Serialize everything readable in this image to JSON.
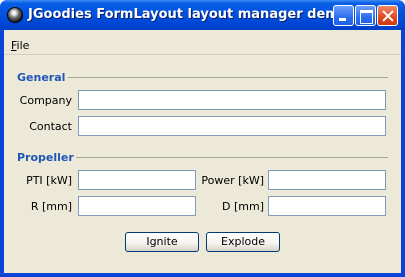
{
  "window": {
    "title": "JGoodies FormLayout layout manager demo"
  },
  "menu": {
    "file_mnemonic": "F",
    "file_rest": "ile"
  },
  "sections": {
    "general": {
      "title": "General",
      "company_label": "Company",
      "company_value": "",
      "contact_label": "Contact",
      "contact_value": ""
    },
    "propeller": {
      "title": "Propeller",
      "pti_label": "PTI [kW]",
      "pti_value": "",
      "power_label": "Power [kW]",
      "power_value": "",
      "r_label": "R [mm]",
      "r_value": "",
      "d_label": "D [mm]",
      "d_value": ""
    }
  },
  "buttons": {
    "ignite": "Ignite",
    "explode": "Explode"
  },
  "colors": {
    "titlebar": "#0052e0",
    "separator_title": "#1f56b8",
    "client_bg": "#ece9d8",
    "field_border": "#7f9db9"
  },
  "icons": [
    "app-icon",
    "minimize-icon",
    "maximize-icon",
    "close-icon"
  ]
}
